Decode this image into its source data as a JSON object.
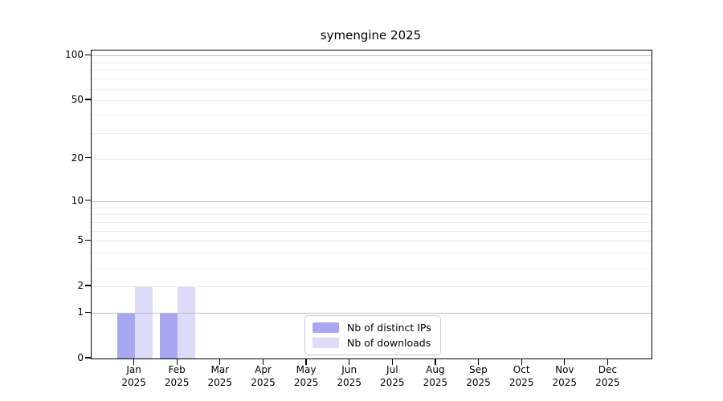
{
  "chart_data": {
    "type": "bar",
    "title": "symengine 2025",
    "months": [
      "Jan",
      "Feb",
      "Mar",
      "Apr",
      "May",
      "Jun",
      "Jul",
      "Aug",
      "Sep",
      "Oct",
      "Nov",
      "Dec"
    ],
    "year": "2025",
    "categories": [
      "Jan 2025",
      "Feb 2025",
      "Mar 2025",
      "Apr 2025",
      "May 2025",
      "Jun 2025",
      "Jul 2025",
      "Aug 2025",
      "Sep 2025",
      "Oct 2025",
      "Nov 2025",
      "Dec 2025"
    ],
    "series": [
      {
        "name": "Nb of distinct IPs",
        "color": "#a8a8f2",
        "values": [
          1,
          1,
          0,
          0,
          0,
          0,
          0,
          0,
          0,
          0,
          0,
          0
        ]
      },
      {
        "name": "Nb of downloads",
        "color": "#dcdcfa",
        "values": [
          2,
          2,
          0,
          0,
          0,
          0,
          0,
          0,
          0,
          0,
          0,
          0
        ]
      }
    ],
    "xlabel": "",
    "ylabel": "",
    "y_scale": "log1p",
    "ylim": [
      0,
      110
    ],
    "y_ticks": [
      0,
      1,
      2,
      5,
      10,
      20,
      50,
      100
    ],
    "y_minor_ticks": [
      3,
      4,
      6,
      7,
      8,
      9,
      30,
      40,
      60,
      70,
      80,
      90
    ],
    "y_major_grid": [
      1,
      10,
      100
    ],
    "grid": "on",
    "legend_position": "lower center"
  }
}
